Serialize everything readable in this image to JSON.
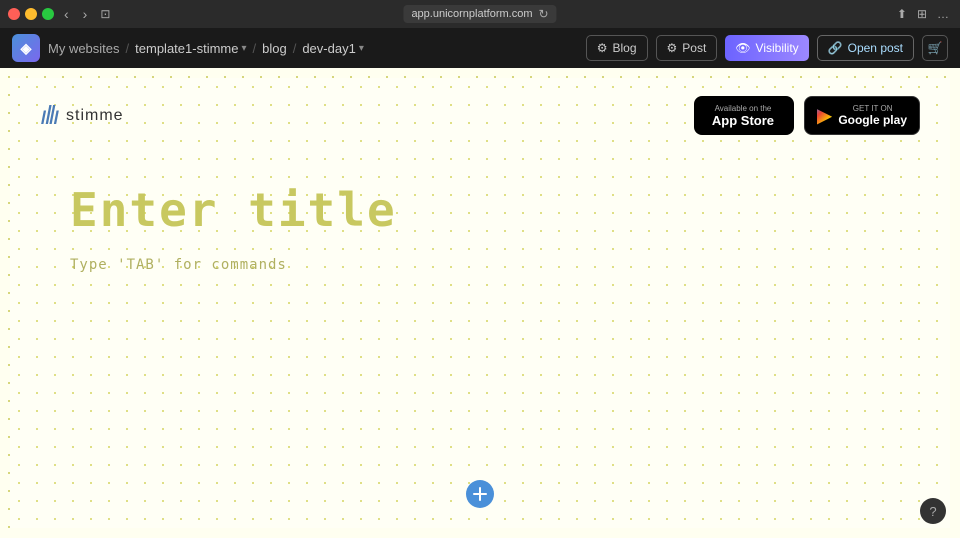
{
  "titlebar": {
    "url": "app.unicornplatform.com",
    "nav_back": "‹",
    "nav_forward": "›"
  },
  "appnav": {
    "logo_symbol": "◈",
    "my_websites": "My websites",
    "sep1": "/",
    "template": "template1-stimme",
    "sep2": "/",
    "blog": "blog",
    "sep3": "/",
    "devday": "dev-day1",
    "blog_label": "Blog",
    "post_label": "Post",
    "visibility_label": "Visibility",
    "open_post_label": "Open post",
    "cart_icon": "🛒"
  },
  "site": {
    "logo_name": "stimme",
    "waves_icon": "〜",
    "appstore": {
      "available": "Available on the",
      "name": "App Store",
      "icon": ""
    },
    "googleplay": {
      "get_it": "GET IT ON",
      "name": "Google play",
      "icon": "▶"
    },
    "editor_title": "Enter title",
    "editor_hint": "Type 'TAB' for commands"
  },
  "help": {
    "symbol": "?"
  }
}
